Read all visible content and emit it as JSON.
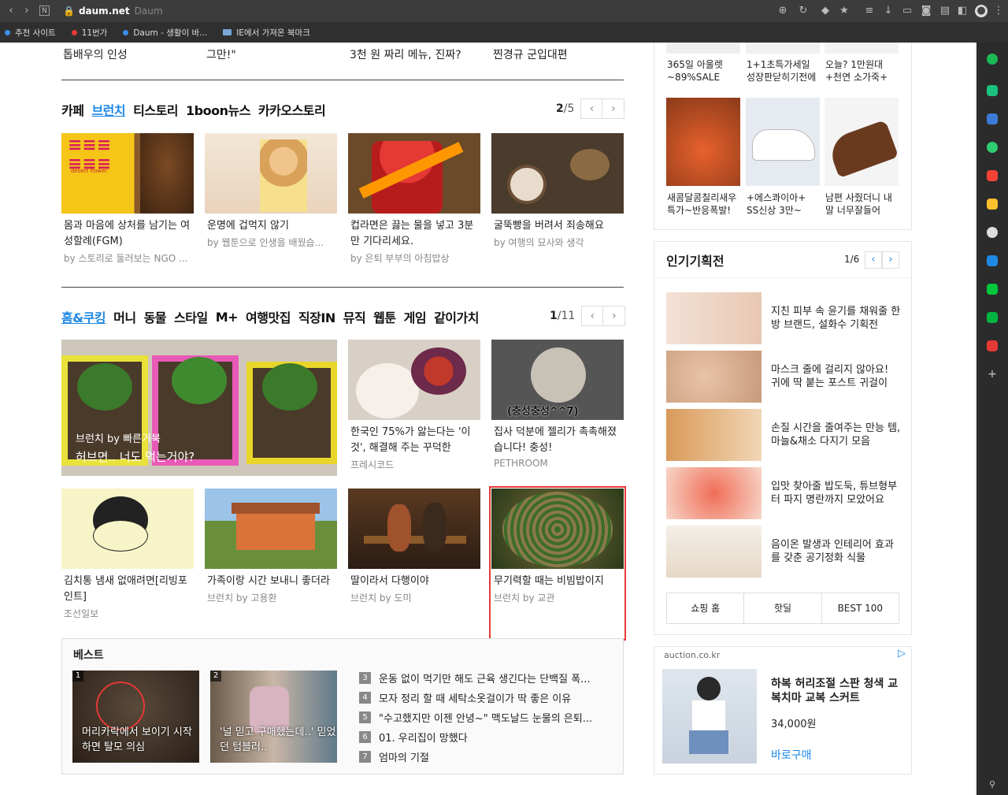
{
  "browser": {
    "host": "daum.net",
    "site_name": "Daum",
    "bookmarks": [
      {
        "label": "추천 사이트",
        "color": "#3b8eea"
      },
      {
        "label": "11번가",
        "color": "#e53935"
      },
      {
        "label": "Daum - 생활이 바...",
        "color": "#3b8eea"
      },
      {
        "label": "IE에서 가져온 북마크",
        "color": "#7aa7d8"
      }
    ]
  },
  "top_news": [
    "톱배우의 인성",
    "그만!\"",
    "3천 원 짜리 메뉴, 진짜?",
    "찐경규 군입대편"
  ],
  "section1": {
    "tabs": [
      "카페",
      "브런치",
      "티스토리",
      "1boon뉴스",
      "카카오스토리"
    ],
    "active_tab": "브런치",
    "page_current": "2",
    "page_total": "/5",
    "cards": [
      {
        "title": "몸과 마음에 상처를 남기는 여성할례(FGM)",
        "source": "by 스토리로 둘러보는 NGO ...",
        "thumb_label": "desert flower"
      },
      {
        "title": "운명에 겁먹지 않기",
        "source": "by 웹툰으로 인생을 배웠습...",
        "thumb_label": ""
      },
      {
        "title": "컵라면은 끓는 물을 넣고 3분만 기다리세요.",
        "source": "by 은퇴 부부의 아침밥상",
        "thumb_label": ""
      },
      {
        "title": "굴뚝빵을 버려서 죄송해요",
        "source": "by 여행의 묘사와 생각",
        "thumb_label": ""
      }
    ]
  },
  "section2": {
    "tabs": [
      "홈&쿠킹",
      "머니",
      "동물",
      "스타일",
      "M+",
      "여행맛집",
      "직장IN",
      "뮤직",
      "웹툰",
      "게임",
      "같이가치"
    ],
    "active_tab": "홈&쿠킹",
    "page_current": "1",
    "page_total": "/11",
    "big": {
      "source": "브런치 by 빠른거북",
      "title": "허브면.. 너도 먹는거야?"
    },
    "cards": [
      {
        "title": "한국인 75%가 앓는다는 '이것', 해결해 주는 꾸덕한",
        "source": "프레시코드"
      },
      {
        "title": "집사 덕분에 젤리가 촉촉해졌습니다! 충성!",
        "source": "PETHROOM",
        "overlay": "(충성충성^^7)"
      },
      {
        "title": "김치통 냄새 없애려면[리빙포인트]",
        "source": "조선일보"
      },
      {
        "title": "가족이랑 시간 보내니 좋더라",
        "source": "브런치 by 고용환"
      },
      {
        "title": "딸이라서 다행이야",
        "source": "브런치 by 도미"
      },
      {
        "title": "무기력할 때는 비빔밥이지",
        "source": "브런치 by 교관"
      }
    ]
  },
  "best": {
    "title": "베스트",
    "thumbs": [
      {
        "num": "1",
        "caption": "머리카락에서 보이기 시작하면 탈모 의심"
      },
      {
        "num": "2",
        "caption": "'널 믿고 구매했는데..' 믿었던 텀블러.."
      }
    ],
    "list": [
      {
        "num": "3",
        "text": "운동 없이 먹기만 해도 근육 생긴다는 단백질 폭..."
      },
      {
        "num": "4",
        "text": "모자 정리 할 때 세탁소옷걸이가 딱 좋은 이유"
      },
      {
        "num": "5",
        "text": "\"수고했지만 이젠 안녕~\" 맥도날드 눈물의 은퇴..."
      },
      {
        "num": "6",
        "text": "01. 우리집이 망했다"
      },
      {
        "num": "7",
        "text": "엄마의 기절"
      }
    ]
  },
  "shopping": {
    "top_row": [
      "365일 아울렛 ~89%SALE",
      "1+1초특가세일 성장판닫히기전에",
      "오늘? 1만원대 +천연 소가죽+"
    ],
    "items": [
      {
        "label": "새콤달콤칠리새우 특가~반응폭발!"
      },
      {
        "label": "+에스콰이아+ SS신상 3만~"
      },
      {
        "label": "남편 사줬더니 내말 너무잘들어"
      }
    ]
  },
  "popular": {
    "title": "인기기획전",
    "page": "1/6",
    "items": [
      "지친 피부 속 윤기를 채워줄 한방 브랜드, 설화수 기획전",
      "마스크 줄에 걸리지 않아요! 귀에 딱 붙는 포스트 귀걸이",
      "손질 시간을 줄여주는 만능 템, 마늘&채소 다지기 모음",
      "입맛 찾아줄 밥도둑, 튜브형부터 파지 명란까지 모았어요",
      "음이온 발생과 인테리어 효과를 갖춘 공기정화 식물"
    ],
    "buttons": [
      "쇼핑 홈",
      "핫딜",
      "BEST 100"
    ]
  },
  "ad": {
    "domain": "auction.co.kr",
    "title": "하복 허리조절 스판 청색 교복치마 교복 스커트",
    "price": "34,000원",
    "cta": "바로구매"
  }
}
